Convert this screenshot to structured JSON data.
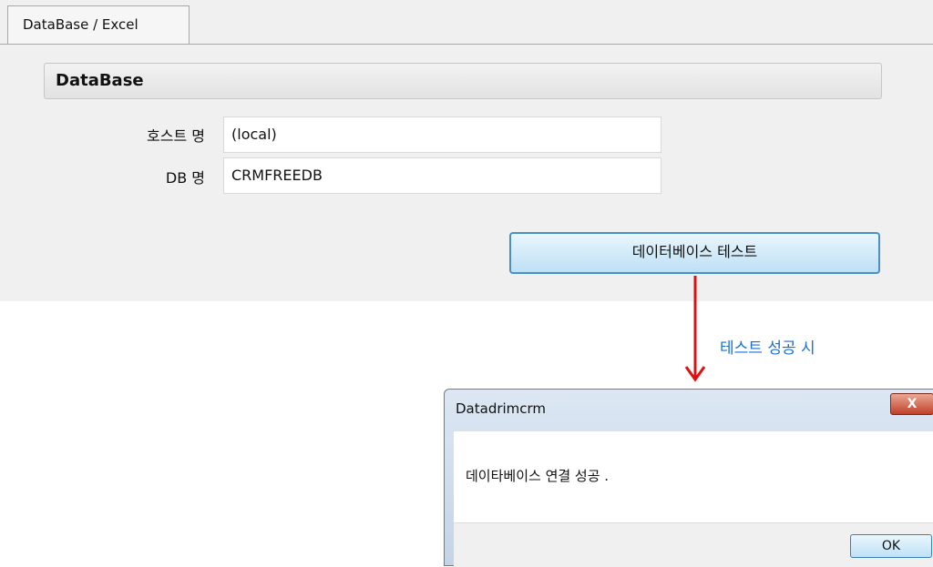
{
  "settings": {
    "tab_label": "DataBase / Excel",
    "section_title": "DataBase",
    "host_label": "호스트 명",
    "host_value": "(local)",
    "db_label": "DB 명",
    "db_value": "CRMFREEDB",
    "test_button_label": "데이터베이스 테스트"
  },
  "annotation": {
    "text": "테스트 성공 시",
    "arrow_color": "#e01010",
    "text_color": "#1a6fd6"
  },
  "dialog": {
    "title": "Datadrimcrm",
    "close_label": "X",
    "message": "데이타베이스 연결 성공 .",
    "ok_label": "OK"
  }
}
